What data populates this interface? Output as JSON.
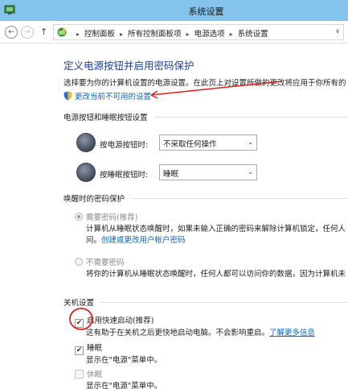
{
  "window": {
    "title": "系统设置"
  },
  "nav": {
    "back_glyph": "←",
    "forward_glyph": "→",
    "up_glyph": "↑",
    "breadcrumbs": [
      "控制面板",
      "所有控制面板项",
      "电源选项",
      "系统设置"
    ],
    "sep_glyph": "▸",
    "dropdown_glyph": "∨"
  },
  "page": {
    "heading": "定义电源按钮并启用密码保护",
    "description": "选择要为你的计算机设置的电源设置。在此页上对设置所做的更改将应用于你所有的",
    "change_link": "更改当前不可用的设置"
  },
  "power_section": {
    "label": "电源按钮和睡眠按钮设置",
    "power_button": {
      "label": "按电源按钮时:",
      "value": "不采取任何操作"
    },
    "sleep_button": {
      "label": "按睡眠按钮时:",
      "value": "睡眠"
    }
  },
  "wake_section": {
    "label": "唤醒时的密码保护",
    "require": {
      "label": "需要密码(推荐)",
      "text": "计算机从睡眠状态唤醒时，如果未输入正确的密码来解除计算机锁定，任何人",
      "text2_prefix": "问。",
      "link": "创建或更改用户帐户密码"
    },
    "no_password": {
      "label": "不需要密码",
      "text": "将你的计算机从睡眠状态唤醒时，任何人都可以访问你的数据，因为计算机未"
    }
  },
  "shutdown_section": {
    "label": "关机设置",
    "fast_startup": {
      "label": "启用快速启动(推荐)",
      "hint": "这有助于在关机之后更快地启动电脑。不会影响重启。",
      "link": "了解更多信息",
      "checked": true
    },
    "sleep": {
      "label": "睡眠",
      "hint": "显示在\"电源\"菜单中。",
      "checked": true
    },
    "hibernate": {
      "label": "休眠",
      "hint": "显示在\"电源\"菜单中。",
      "checked": false
    }
  },
  "checkmark_glyph": "✔",
  "combo_arrow_glyph": "⌄",
  "colors": {
    "title_bar": "#84c3ec",
    "heading": "#1f3f9a",
    "link": "#0b64c0",
    "annotation_red": "#e02020"
  }
}
